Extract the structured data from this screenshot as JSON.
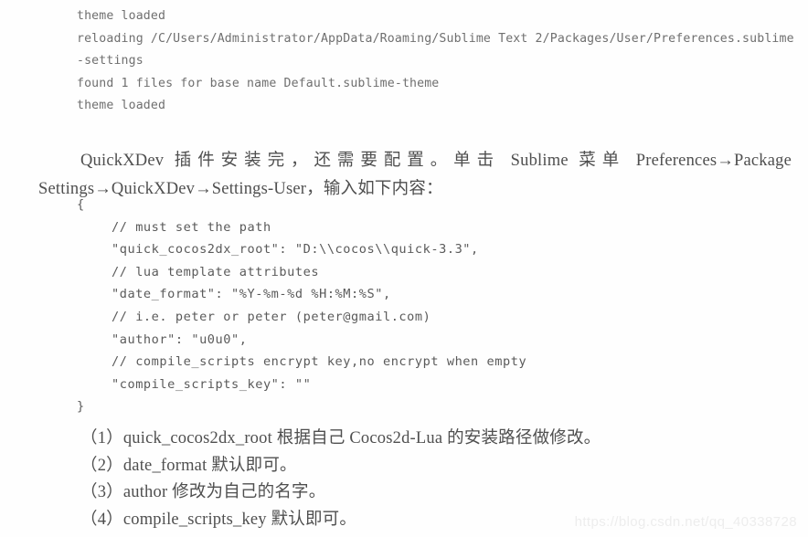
{
  "console_log": {
    "lines": [
      "theme loaded",
      "reloading /C/Users/Administrator/AppData/Roaming/Sublime Text 2/Packages/User/Preferences.sublime-settings",
      "found 1 files for base name Default.sublime-theme",
      "theme loaded"
    ]
  },
  "paragraph": {
    "text": "QuickXDev 插件安装完，还需要配置。单击 Sublime 菜单 Preferences→Package Settings→QuickXDev→Settings-User，输入如下内容："
  },
  "code_block": {
    "lines": [
      "{",
      "// must set the path",
      "\"quick_cocos2dx_root\": \"D:\\\\cocos\\\\quick-3.3\",",
      "// lua template attributes",
      "\"date_format\": \"%Y-%m-%d %H:%M:%S\",",
      "// i.e. peter or peter (peter@gmail.com)",
      "\"author\": \"u0u0\",",
      "// compile_scripts encrypt key,no encrypt when empty",
      "\"compile_scripts_key\": \"\"",
      "}"
    ]
  },
  "numbered_list": {
    "items": [
      "（1）quick_cocos2dx_root 根据自己 Cocos2d-Lua 的安装路径做修改。",
      "（2）date_format 默认即可。",
      "（3）author 修改为自己的名字。",
      "（4）compile_scripts_key 默认即可。"
    ]
  },
  "watermark": {
    "text": "https://blog.csdn.net/qq_40338728"
  },
  "colors": {
    "page_background": "#fefefe",
    "body_text": "#4f4f4f",
    "code_text": "#5a5a5a",
    "console_text": "#6f6f6f",
    "watermark_text": "#ededed"
  }
}
